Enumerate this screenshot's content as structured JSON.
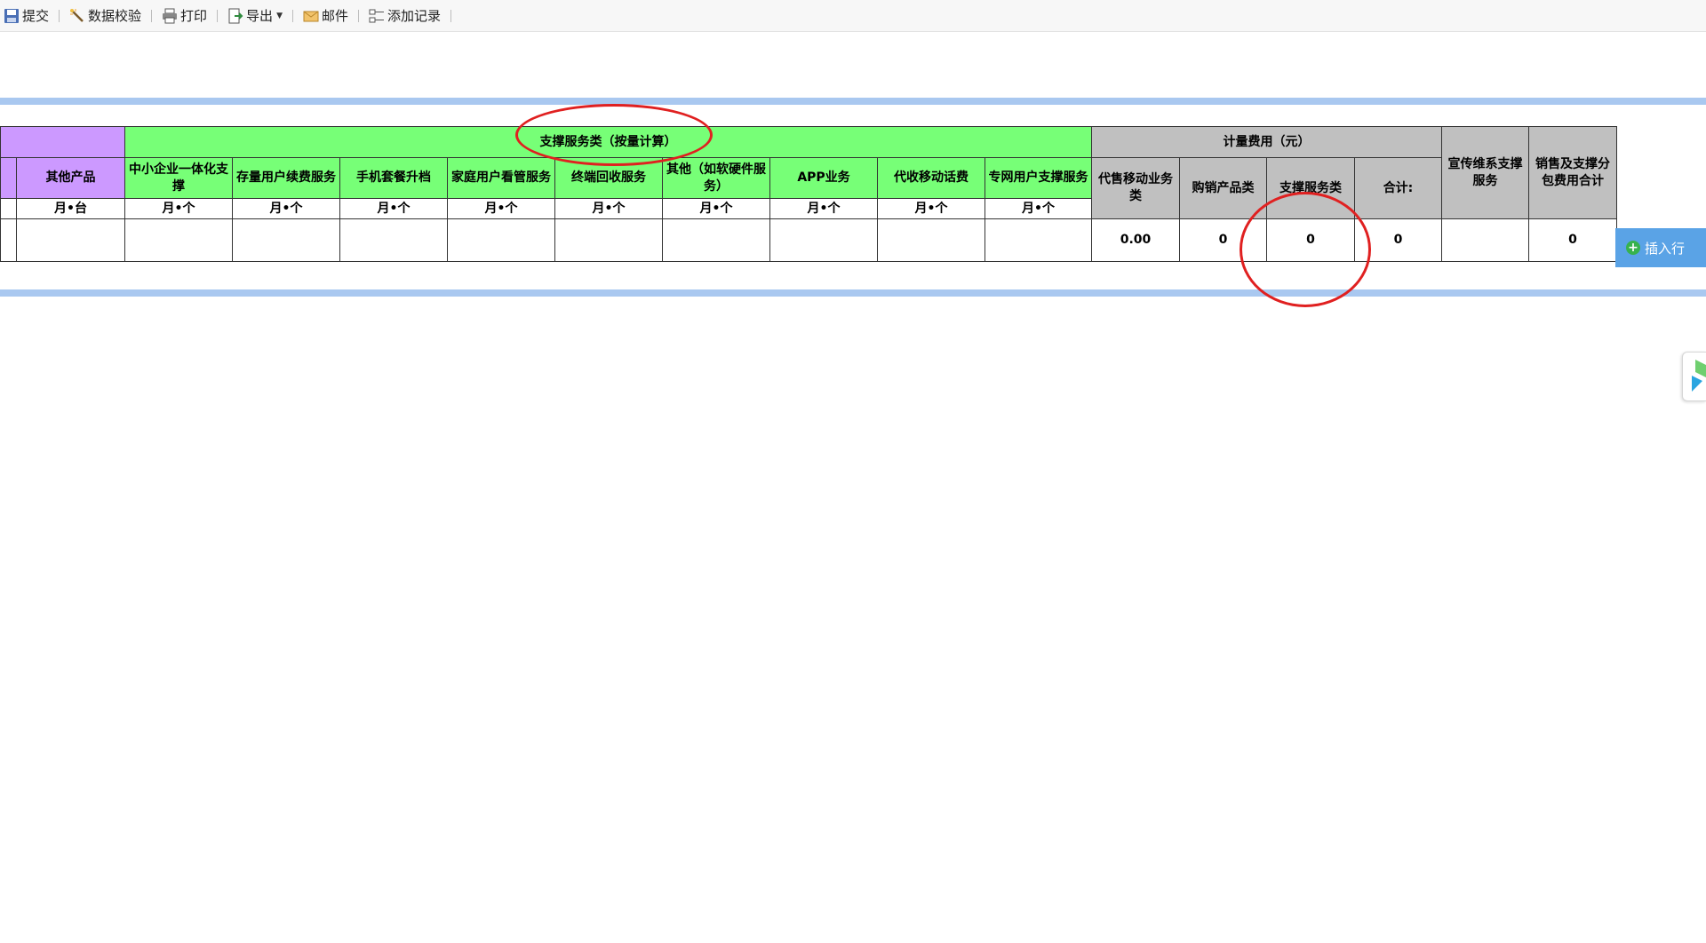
{
  "toolbar": {
    "submit": "提交",
    "validate": "数据校验",
    "print": "打印",
    "export": "导出",
    "mail": "邮件",
    "add_record": "添加记录"
  },
  "table": {
    "header_group_support": "支撑服务类（按量计算）",
    "header_group_fee": "计量费用（元）",
    "header_promo": "宣传维系支撑服务",
    "header_sales_total": "销售及支撑分包费用合计",
    "col_other_product": "其他产品",
    "support_cols": [
      "中小企业一体化支撑",
      "存量用户续费服务",
      "手机套餐升档",
      "家庭用户看管服务",
      "终端回收服务",
      "其他（如软硬件服务）",
      "APP业务",
      "代收移动话费",
      "专网用户支撑服务"
    ],
    "fee_cols": [
      "代售移动业务类",
      "购销产品类",
      "支撑服务类",
      "合计:"
    ],
    "unit_other": "月•台",
    "unit_support": "月•个",
    "values": {
      "agency": "0.00",
      "purchase_sales": "0",
      "support": "0",
      "sum": "0",
      "sales_total": "0"
    }
  },
  "insert_row": "插入行"
}
